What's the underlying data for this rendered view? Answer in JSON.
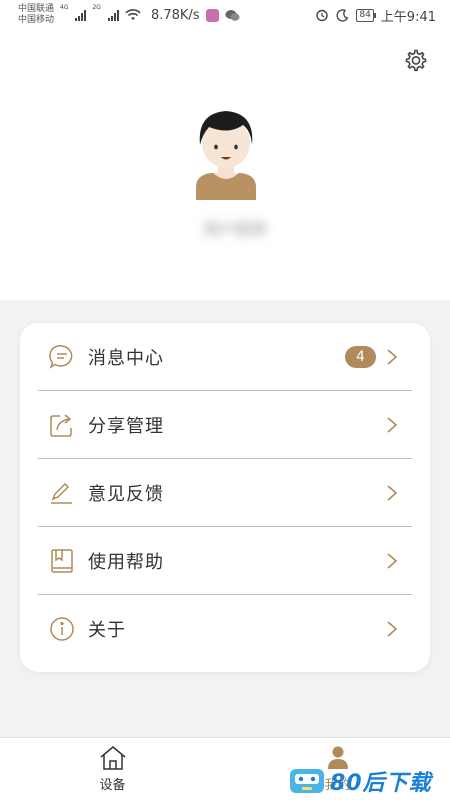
{
  "status_bar": {
    "carrier_1": "中国联通",
    "carrier_2": "中国移动",
    "network_1": "4G",
    "network_2": "2G",
    "net_speed": "8.78K/s",
    "battery": "84",
    "time": "上午9:41"
  },
  "header": {
    "username": "用户昵称"
  },
  "menu": {
    "items": [
      {
        "label": "消息中心",
        "icon": "message-icon",
        "badge": "4"
      },
      {
        "label": "分享管理",
        "icon": "share-icon"
      },
      {
        "label": "意见反馈",
        "icon": "edit-icon"
      },
      {
        "label": "使用帮助",
        "icon": "book-icon"
      },
      {
        "label": "关于",
        "icon": "info-icon"
      }
    ]
  },
  "bottom_nav": {
    "items": [
      {
        "label": "设备",
        "icon": "home-icon"
      },
      {
        "label": "我的",
        "icon": "user-icon",
        "active": true
      }
    ]
  },
  "watermark": {
    "text": "80后下载"
  },
  "colors": {
    "accent": "#b08a5a",
    "background": "#f2f2f2",
    "card": "#ffffff"
  }
}
